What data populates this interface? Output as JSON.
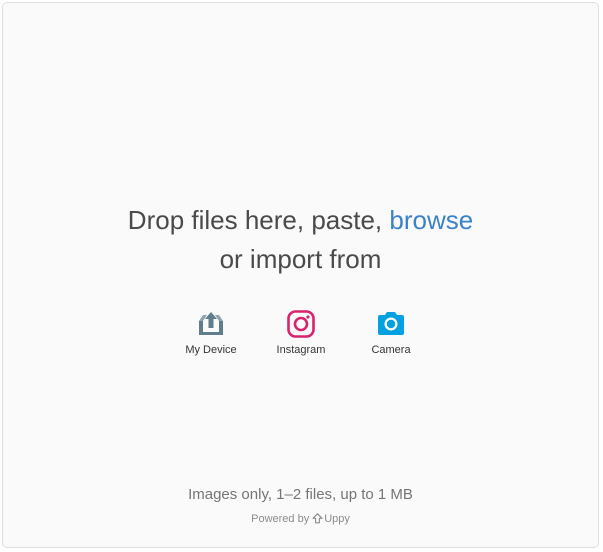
{
  "dropzone": {
    "title_before": "Drop files here, paste, ",
    "browse_label": "browse",
    "title_after": "or import from"
  },
  "providers": [
    {
      "label": "My Device",
      "icon": "upload-tray-icon",
      "color": "#607d8b"
    },
    {
      "label": "Instagram",
      "icon": "instagram-icon",
      "color": "#d6246e"
    },
    {
      "label": "Camera",
      "icon": "camera-icon",
      "color": "#03a1e0"
    }
  ],
  "footer": {
    "note": "Images only, 1–2 files, up to 1 MB",
    "powered_prefix": "Powered by",
    "brand": "Uppy"
  }
}
